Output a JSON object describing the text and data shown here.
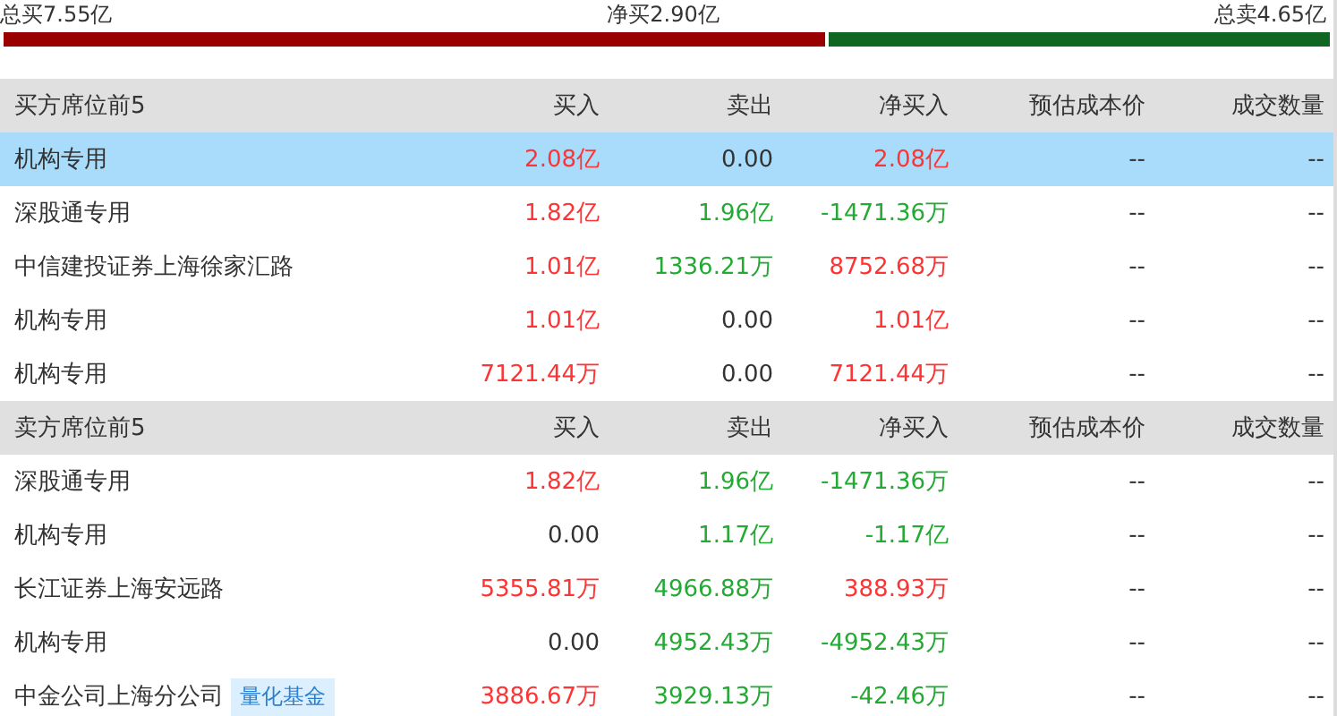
{
  "summary": {
    "total_buy": "总买7.55亿",
    "net_buy": "净买2.90亿",
    "total_sell": "总卖4.65亿",
    "level": 0.619
  },
  "sections": [
    {
      "columns": [
        "买方席位前5",
        "买入",
        "卖出",
        "净买入",
        "预估成本价",
        "成交数量"
      ],
      "rows": [
        {
          "selected": true,
          "cells": [
            {
              "text": "机构专用"
            },
            {
              "text": "2.08亿",
              "color": "#ff3333"
            },
            {
              "text": "0.00",
              "color": "#333333"
            },
            {
              "text": "2.08亿",
              "color": "#ff3333"
            },
            {
              "text": "--",
              "color": "#333333"
            },
            {
              "text": "--",
              "color": "#333333"
            }
          ]
        },
        {
          "selected": false,
          "cells": [
            {
              "text": "深股通专用"
            },
            {
              "text": "1.82亿",
              "color": "#ff3333"
            },
            {
              "text": "1.96亿",
              "color": "#22aa33"
            },
            {
              "text": "-1471.36万",
              "color": "#22aa33"
            },
            {
              "text": "--",
              "color": "#333333"
            },
            {
              "text": "--",
              "color": "#333333"
            }
          ]
        },
        {
          "selected": false,
          "cells": [
            {
              "text": "中信建投证券上海徐家汇路"
            },
            {
              "text": "1.01亿",
              "color": "#ff3333"
            },
            {
              "text": "1336.21万",
              "color": "#22aa33"
            },
            {
              "text": "8752.68万",
              "color": "#ff3333"
            },
            {
              "text": "--",
              "color": "#333333"
            },
            {
              "text": "--",
              "color": "#333333"
            }
          ]
        },
        {
          "selected": false,
          "cells": [
            {
              "text": "机构专用"
            },
            {
              "text": "1.01亿",
              "color": "#ff3333"
            },
            {
              "text": "0.00",
              "color": "#333333"
            },
            {
              "text": "1.01亿",
              "color": "#ff3333"
            },
            {
              "text": "--",
              "color": "#333333"
            },
            {
              "text": "--",
              "color": "#333333"
            }
          ]
        },
        {
          "selected": false,
          "cells": [
            {
              "text": "机构专用"
            },
            {
              "text": "7121.44万",
              "color": "#ff3333"
            },
            {
              "text": "0.00",
              "color": "#333333"
            },
            {
              "text": "7121.44万",
              "color": "#ff3333"
            },
            {
              "text": "--",
              "color": "#333333"
            },
            {
              "text": "--",
              "color": "#333333"
            }
          ]
        }
      ]
    },
    {
      "columns": [
        "卖方席位前5",
        "买入",
        "卖出",
        "净买入",
        "预估成本价",
        "成交数量"
      ],
      "rows": [
        {
          "selected": false,
          "cells": [
            {
              "text": "深股通专用"
            },
            {
              "text": "1.82亿",
              "color": "#ff3333"
            },
            {
              "text": "1.96亿",
              "color": "#22aa33"
            },
            {
              "text": "-1471.36万",
              "color": "#22aa33"
            },
            {
              "text": "--",
              "color": "#333333"
            },
            {
              "text": "--",
              "color": "#333333"
            }
          ]
        },
        {
          "selected": false,
          "cells": [
            {
              "text": "机构专用"
            },
            {
              "text": "0.00",
              "color": "#333333"
            },
            {
              "text": "1.17亿",
              "color": "#22aa33"
            },
            {
              "text": "-1.17亿",
              "color": "#22aa33"
            },
            {
              "text": "--",
              "color": "#333333"
            },
            {
              "text": "--",
              "color": "#333333"
            }
          ]
        },
        {
          "selected": false,
          "cells": [
            {
              "text": "长江证券上海安远路"
            },
            {
              "text": "5355.81万",
              "color": "#ff3333"
            },
            {
              "text": "4966.88万",
              "color": "#22aa33"
            },
            {
              "text": "388.93万",
              "color": "#ff3333"
            },
            {
              "text": "--",
              "color": "#333333"
            },
            {
              "text": "--",
              "color": "#333333"
            }
          ]
        },
        {
          "selected": false,
          "cells": [
            {
              "text": "机构专用"
            },
            {
              "text": "0.00",
              "color": "#333333"
            },
            {
              "text": "4952.43万",
              "color": "#22aa33"
            },
            {
              "text": "-4952.43万",
              "color": "#22aa33"
            },
            {
              "text": "--",
              "color": "#333333"
            },
            {
              "text": "--",
              "color": "#333333"
            }
          ]
        },
        {
          "selected": false,
          "cells": [
            {
              "text": "中金公司上海分公司",
              "tag": "量化基金"
            },
            {
              "text": "3886.67万",
              "color": "#ff3333"
            },
            {
              "text": "3929.13万",
              "color": "#22aa33"
            },
            {
              "text": "-42.46万",
              "color": "#22aa33"
            },
            {
              "text": "--",
              "color": "#333333"
            },
            {
              "text": "--",
              "color": "#333333"
            }
          ]
        }
      ]
    }
  ]
}
